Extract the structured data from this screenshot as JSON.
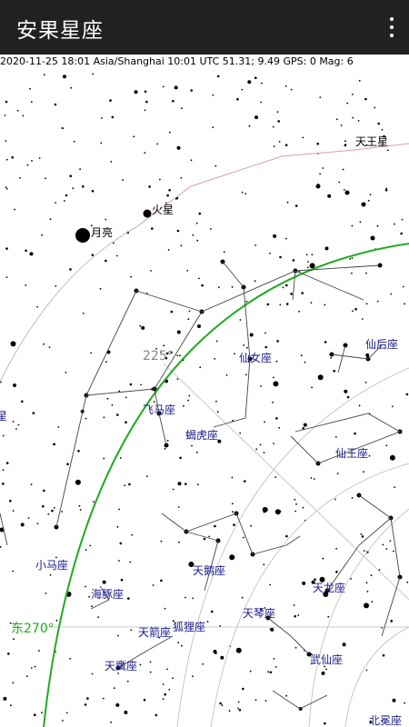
{
  "app": {
    "title": "安果星座"
  },
  "status": {
    "line": "2020-11-25  18:01 Asia/Shanghai  10:01 UTC  51.31; 9.49 GPS: 0  Mag: 6"
  },
  "planets": {
    "uranus": "天王星",
    "mars": "火星",
    "moon": "月亮"
  },
  "grid": {
    "az225": "225°",
    "east270": "东270°"
  },
  "constellations": {
    "andromeda": "仙女座",
    "cassiopeia": "仙后座",
    "pegasus": "飞马座",
    "lacerta": "蝎虎座",
    "cepheus": "仙王座",
    "equuleus": "小马座",
    "delphinus": "海豚座",
    "cygnus": "天鹅座",
    "draco": "天龙座",
    "lyra": "天琴座",
    "vulpecula": "狐狸座",
    "sagitta": "天箭座",
    "aquila": "天鹰座",
    "hercules": "武仙座",
    "corona": "北冕座",
    "edge_left": "星"
  },
  "colors": {
    "appbar": "#212121",
    "horizon": "#22aa22",
    "ecliptic": "#d8a0a0",
    "constellation_text": "#1a1a8c"
  }
}
